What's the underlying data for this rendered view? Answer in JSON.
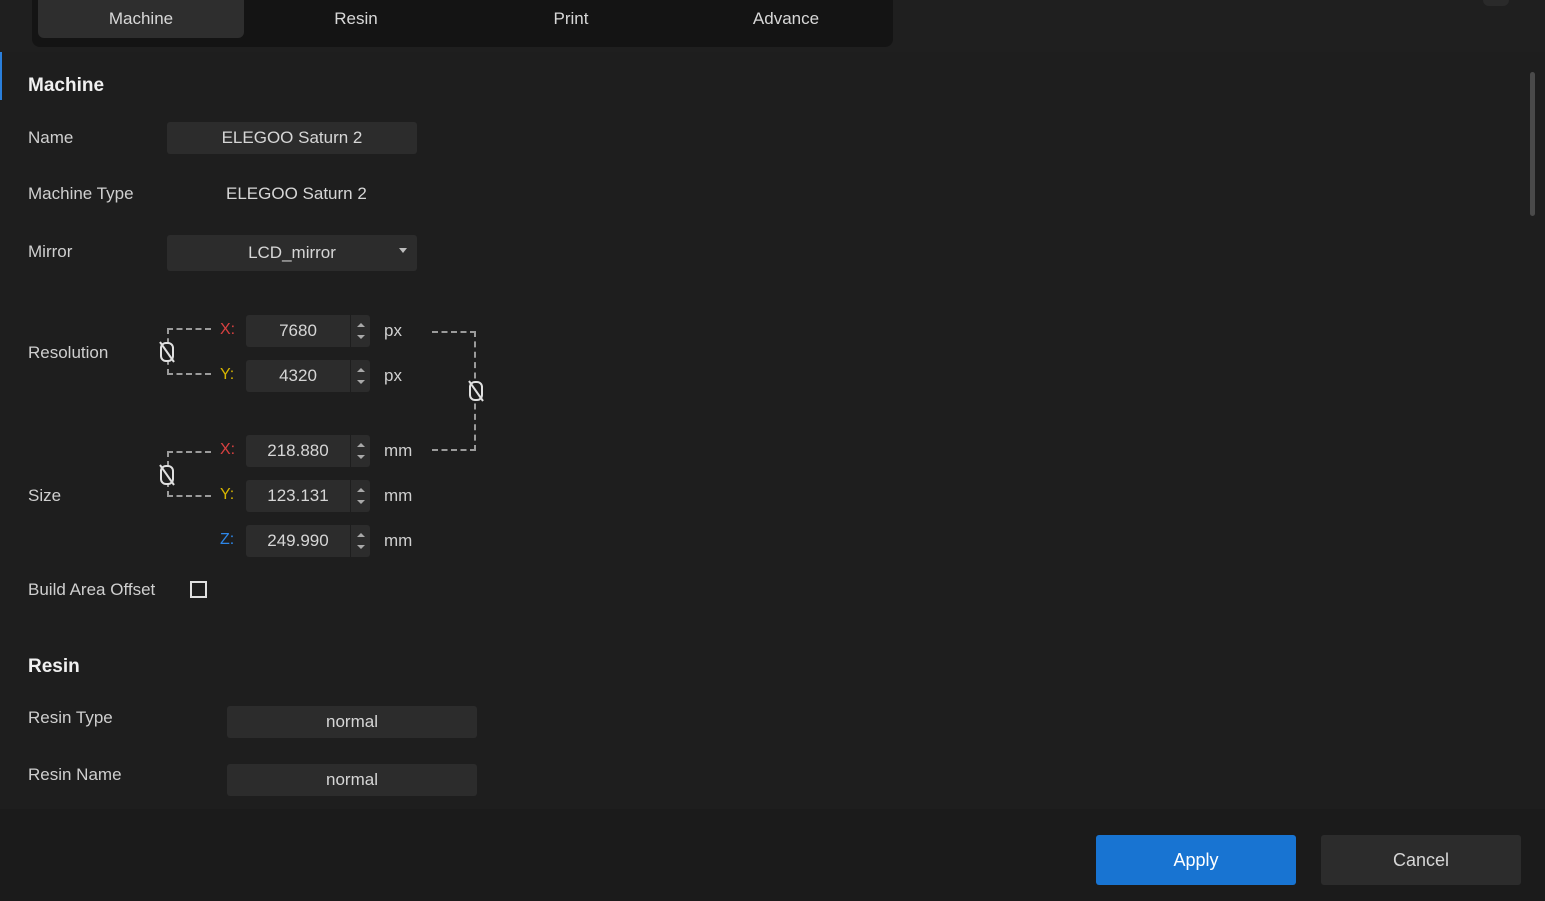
{
  "tabs": [
    {
      "label": "Machine",
      "active": true
    },
    {
      "label": "Resin",
      "active": false
    },
    {
      "label": "Print",
      "active": false
    },
    {
      "label": "Advance",
      "active": false
    }
  ],
  "machine": {
    "title": "Machine",
    "name_label": "Name",
    "name_value": "ELEGOO Saturn 2",
    "type_label": "Machine Type",
    "type_value": "ELEGOO Saturn 2",
    "mirror_label": "Mirror",
    "mirror_value": "LCD_mirror",
    "resolution_label": "Resolution",
    "resolution": {
      "x_axis": "X:",
      "x_value": "7680",
      "x_unit": "px",
      "y_axis": "Y:",
      "y_value": "4320",
      "y_unit": "px"
    },
    "size_label": "Size",
    "size": {
      "x_axis": "X:",
      "x_value": "218.880",
      "x_unit": "mm",
      "y_axis": "Y:",
      "y_value": "123.131",
      "y_unit": "mm",
      "z_axis": "Z:",
      "z_value": "249.990",
      "z_unit": "mm"
    },
    "build_offset_label": "Build Area Offset",
    "build_offset_checked": false
  },
  "resin": {
    "title": "Resin",
    "type_label": "Resin Type",
    "type_value": "normal",
    "name_label": "Resin Name",
    "name_value": "normal"
  },
  "footer": {
    "apply_label": "Apply",
    "cancel_label": "Cancel"
  },
  "colors": {
    "accent": "#1874d2",
    "axis_x": "#d84040",
    "axis_y": "#d6b400",
    "axis_z": "#2d86e8"
  }
}
